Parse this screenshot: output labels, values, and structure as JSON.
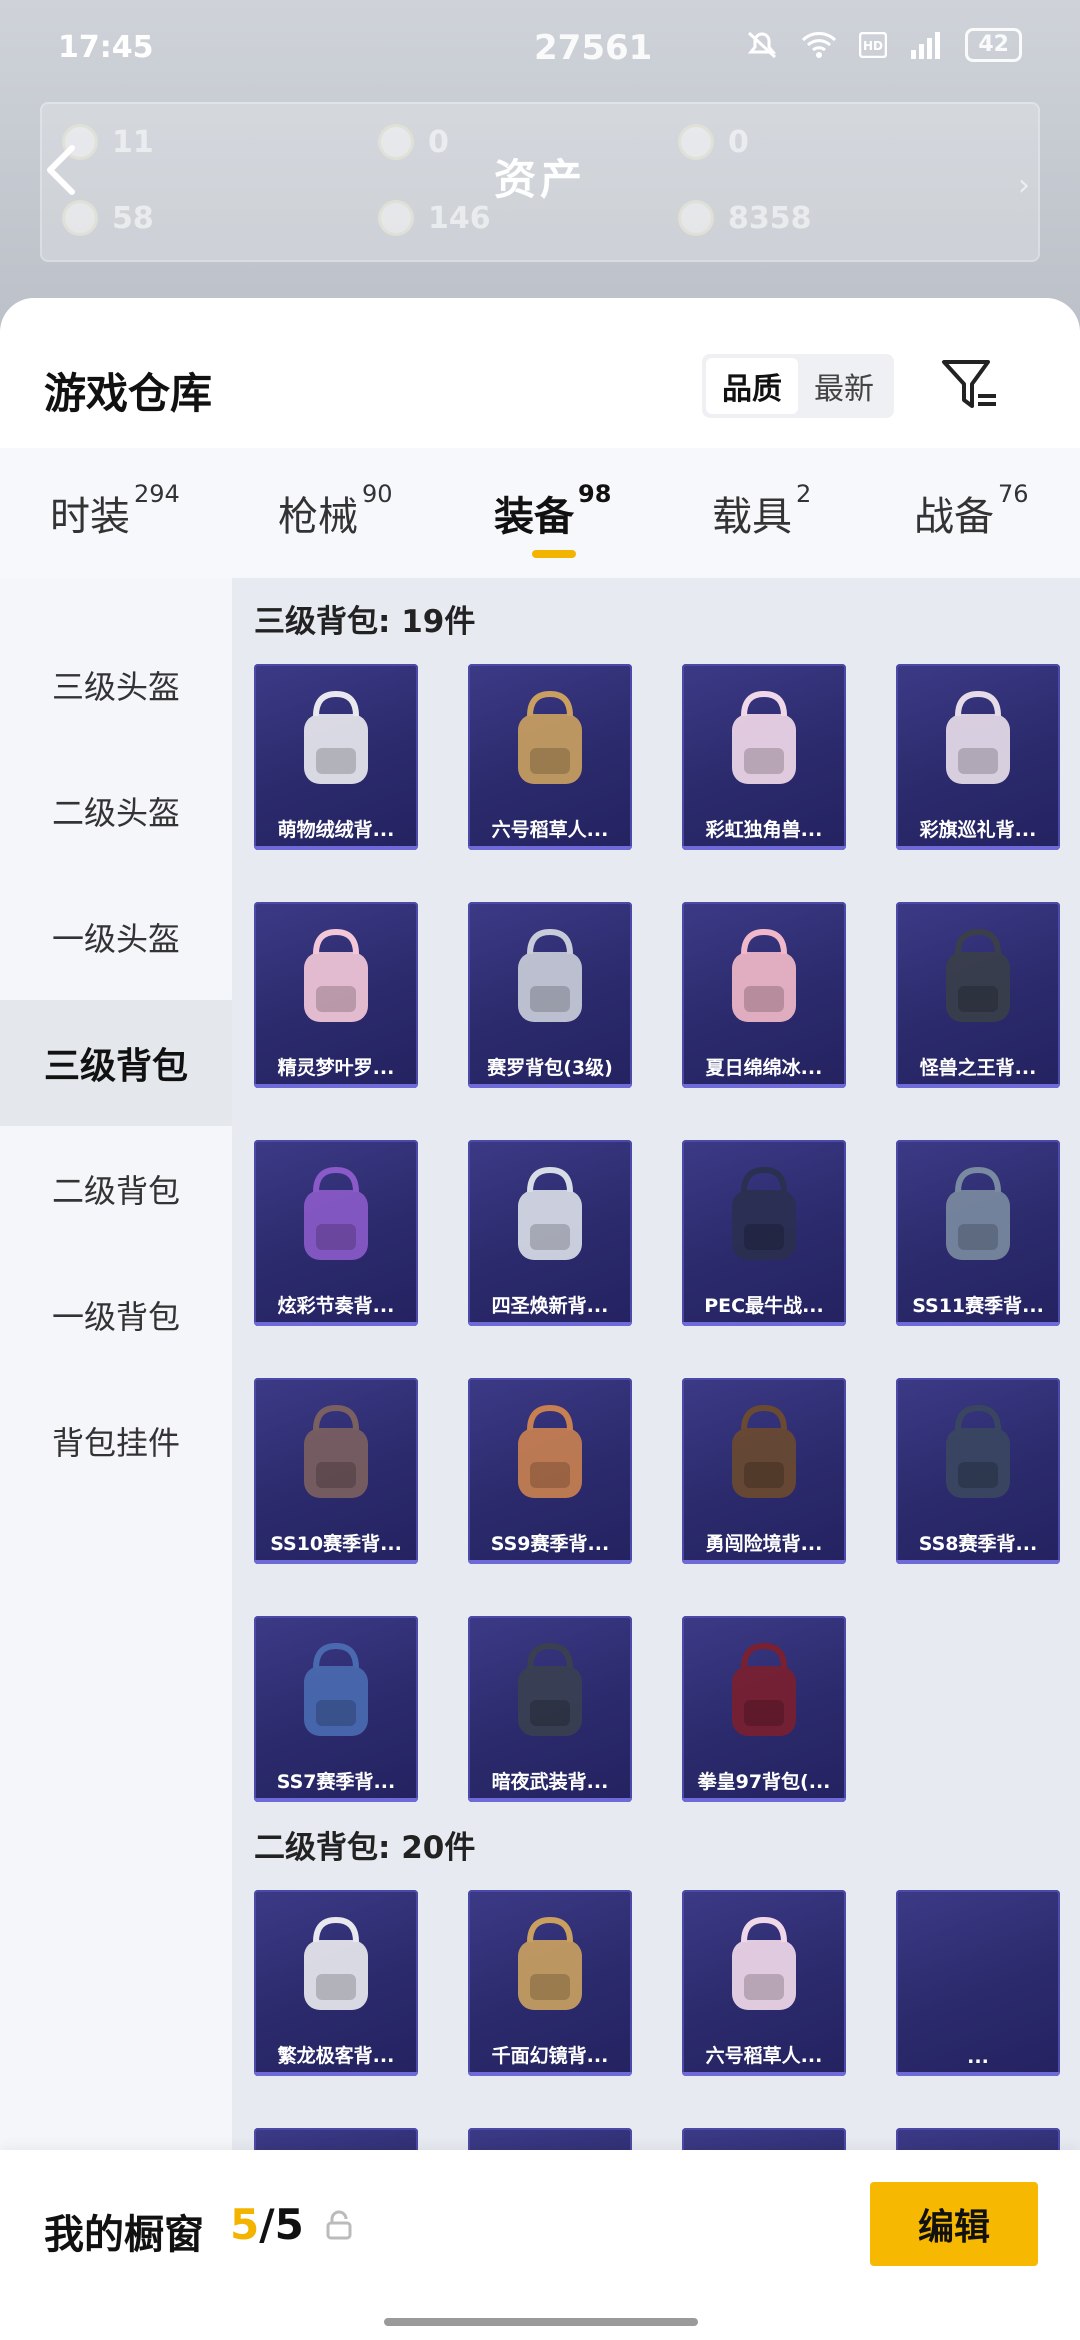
{
  "status_bar": {
    "time": "17:45",
    "center_number": "27561",
    "battery": "42"
  },
  "header": {
    "title": "资产",
    "ghost_values": [
      "11",
      "0",
      "0",
      "58",
      "146",
      "8358"
    ]
  },
  "sheet": {
    "title": "游戏仓库"
  },
  "sort": {
    "options": [
      "品质",
      "最新"
    ],
    "active": "品质"
  },
  "tabs": [
    {
      "label": "时装",
      "count": "294"
    },
    {
      "label": "枪械",
      "count": "90"
    },
    {
      "label": "装备",
      "count": "98"
    },
    {
      "label": "载具",
      "count": "2"
    },
    {
      "label": "战备",
      "count": "76"
    }
  ],
  "active_tab": "装备",
  "sidebar": {
    "items": [
      "三级头盔",
      "二级头盔",
      "一级头盔",
      "三级背包",
      "二级背包",
      "一级背包",
      "背包挂件"
    ],
    "active": "三级背包"
  },
  "sections": [
    {
      "title": "三级背包: 19件",
      "items": [
        "萌物绒绒背...",
        "六号稻草人...",
        "彩虹独角兽...",
        "彩旗巡礼背...",
        "精灵梦叶罗...",
        "赛罗背包(3级)",
        "夏日绵绵冰...",
        "怪兽之王背...",
        "炫彩节奏背...",
        "四圣焕新背...",
        "PEC最牛战...",
        "SS11赛季背...",
        "SS10赛季背...",
        "SS9赛季背...",
        "勇闯险境背...",
        "SS8赛季背...",
        "SS7赛季背...",
        "暗夜武装背...",
        "拳皇97背包(..."
      ]
    },
    {
      "title": "二级背包: 20件",
      "items": [
        "繁龙极客背...",
        "千面幻镜背...",
        "六号稻草人...",
        "..."
      ]
    }
  ],
  "bottom_bar": {
    "label": "我的橱窗",
    "current": "5",
    "total": "/5",
    "edit_label": "编辑"
  },
  "colors": {
    "accent": "#f3b400",
    "card": "#2f2d74",
    "fab": "#f6b10a"
  }
}
